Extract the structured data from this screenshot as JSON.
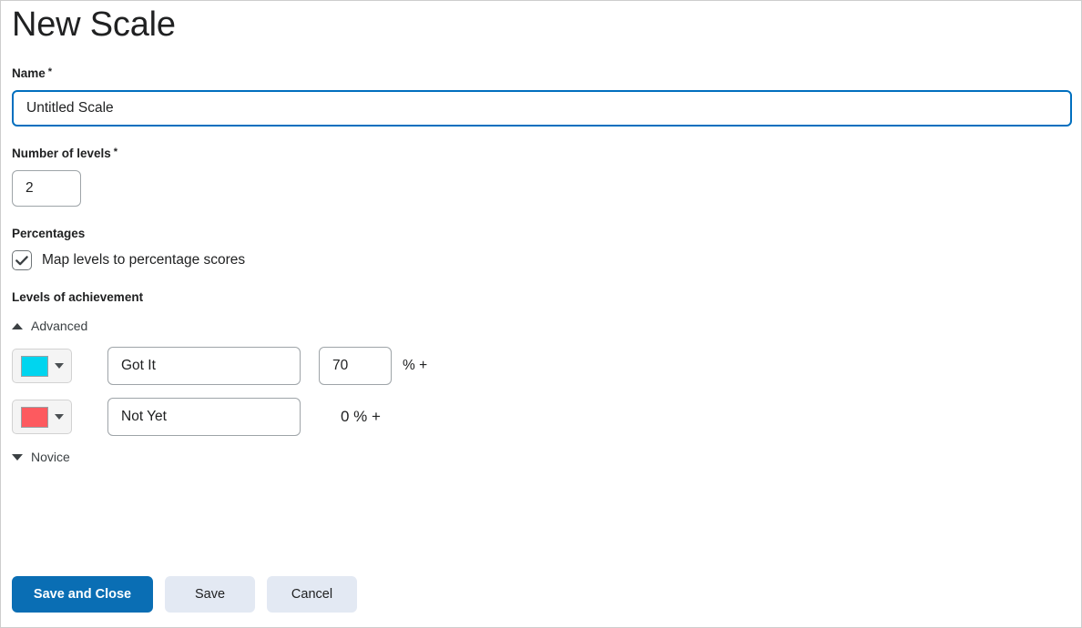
{
  "page": {
    "title": "New Scale"
  },
  "name_field": {
    "label": "Name",
    "required_marker": "*",
    "value": "Untitled Scale",
    "placeholder": "Untitled Scale"
  },
  "levels_field": {
    "label": "Number of levels",
    "required_marker": "*",
    "value": "2",
    "placeholder": "2"
  },
  "percentages": {
    "label": "Percentages",
    "checkbox_label": "Map levels to percentage scores",
    "checked": true
  },
  "levels_of_achievement": {
    "label": "Levels of achievement",
    "advanced_toggle": "Advanced",
    "novice_toggle": "Novice",
    "rows": [
      {
        "color": "#00d5ef",
        "name": "Got It",
        "percent": "70",
        "percent_suffix": "% +",
        "has_percent_input": true
      },
      {
        "color": "#fd5a5f",
        "name": "Not Yet",
        "percent": "0",
        "percent_static": "0 % +",
        "has_percent_input": false
      }
    ]
  },
  "footer": {
    "save_and_close_label": "Save and Close",
    "save_label": "Save",
    "cancel_label": "Cancel"
  },
  "colors": {
    "primary": "#0a6eb4",
    "secondary_bg": "#e3e9f3",
    "focus_border": "#006fbf",
    "text": "#202122",
    "page_border": "#cdcdcd"
  }
}
